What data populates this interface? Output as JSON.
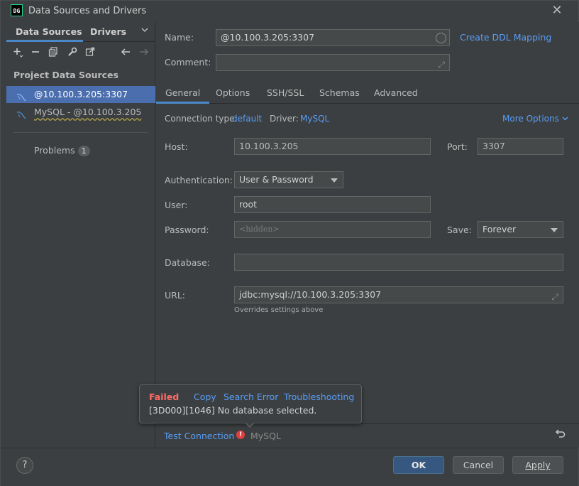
{
  "window": {
    "app_icon_text": "DG",
    "title": "Data Sources and Drivers"
  },
  "left_panel": {
    "tabs": [
      {
        "label": "Data Sources"
      },
      {
        "label": "Drivers"
      }
    ],
    "section_title": "Project Data Sources",
    "items": [
      {
        "label": "@10.100.3.205:3307",
        "selected": true
      },
      {
        "label": "MySQL - @10.100.3.205",
        "selected": false
      }
    ],
    "problems": {
      "label": "Problems",
      "count": "1"
    }
  },
  "header": {
    "name_label": "Name:",
    "name_value": "@10.100.3.205:3307",
    "comment_label": "Comment:",
    "comment_value": "",
    "ddl_link": "Create DDL Mapping"
  },
  "tabs": [
    {
      "label": "General"
    },
    {
      "label": "Options"
    },
    {
      "label": "SSH/SSL"
    },
    {
      "label": "Schemas"
    },
    {
      "label": "Advanced"
    }
  ],
  "general": {
    "connection_type_label": "Connection type:",
    "connection_type_value": "default",
    "driver_label": "Driver:",
    "driver_value": "MySQL",
    "more_options": "More Options",
    "host_label": "Host:",
    "host_value": "10.100.3.205",
    "port_label": "Port:",
    "port_value": "3307",
    "auth_label": "Authentication:",
    "auth_value": "User & Password",
    "user_label": "User:",
    "user_value": "root",
    "password_label": "Password:",
    "password_placeholder": "<hidden>",
    "save_label": "Save:",
    "save_value": "Forever",
    "database_label": "Database:",
    "database_value": "",
    "url_label": "URL:",
    "url_value": "jdbc:mysql://10.100.3.205:3307",
    "url_note": "Overrides settings above"
  },
  "test_bar": {
    "test_connection": "Test Connection",
    "driver_name": "MySQL"
  },
  "popup": {
    "status": "Failed",
    "links": [
      "Copy",
      "Search Error",
      "Troubleshooting"
    ],
    "message": "[3D000][1046] No database selected."
  },
  "footer": {
    "help": "?",
    "ok": "OK",
    "cancel": "Cancel",
    "apply": "Apply"
  },
  "colors": {
    "accent": "#4a88c7",
    "link": "#589df6",
    "selection": "#4b6eaf",
    "error": "#ff6b68",
    "background": "#3c3f41"
  }
}
